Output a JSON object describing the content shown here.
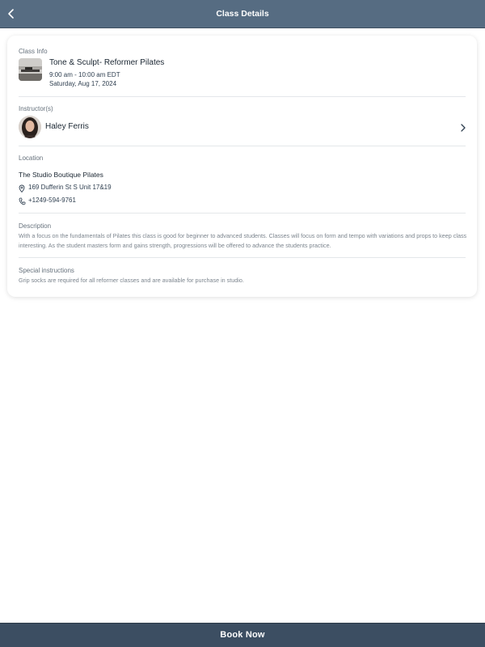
{
  "header": {
    "title": "Class Details",
    "back_icon": "chevron-left-icon"
  },
  "class_info": {
    "label": "Class Info",
    "name": "Tone & Sculpt- Reformer Pilates",
    "time": "9:00 am - 10:00 am EDT",
    "date": "Saturday, Aug 17, 2024"
  },
  "instructors": {
    "label": "Instructor(s)",
    "items": [
      {
        "name": "Haley Ferris"
      }
    ],
    "chevron_icon": "chevron-right-icon"
  },
  "location": {
    "label": "Location",
    "studio": "The Studio Boutique Pilates",
    "address": "169 Dufferin St S Unit 17&19",
    "phone": "+1249-594-9761",
    "address_icon": "map-pin-icon",
    "phone_icon": "phone-icon"
  },
  "description": {
    "label": "Description",
    "text": "With a focus on the fundamentals of Pilates this class is good for beginner to advanced students. Classes will focus on form and tempo with variations and props to keep class interesting. As the student masters form and gains strength, progressions will be offered to advance the students practice."
  },
  "special_instructions": {
    "label": "Special instructions",
    "text": "Grip socks are required for all reformer classes and are available for purchase in studio."
  },
  "footer": {
    "book_label": "Book Now"
  },
  "colors": {
    "header_bg": "#566c82",
    "footer_bg": "#3c4e62"
  }
}
